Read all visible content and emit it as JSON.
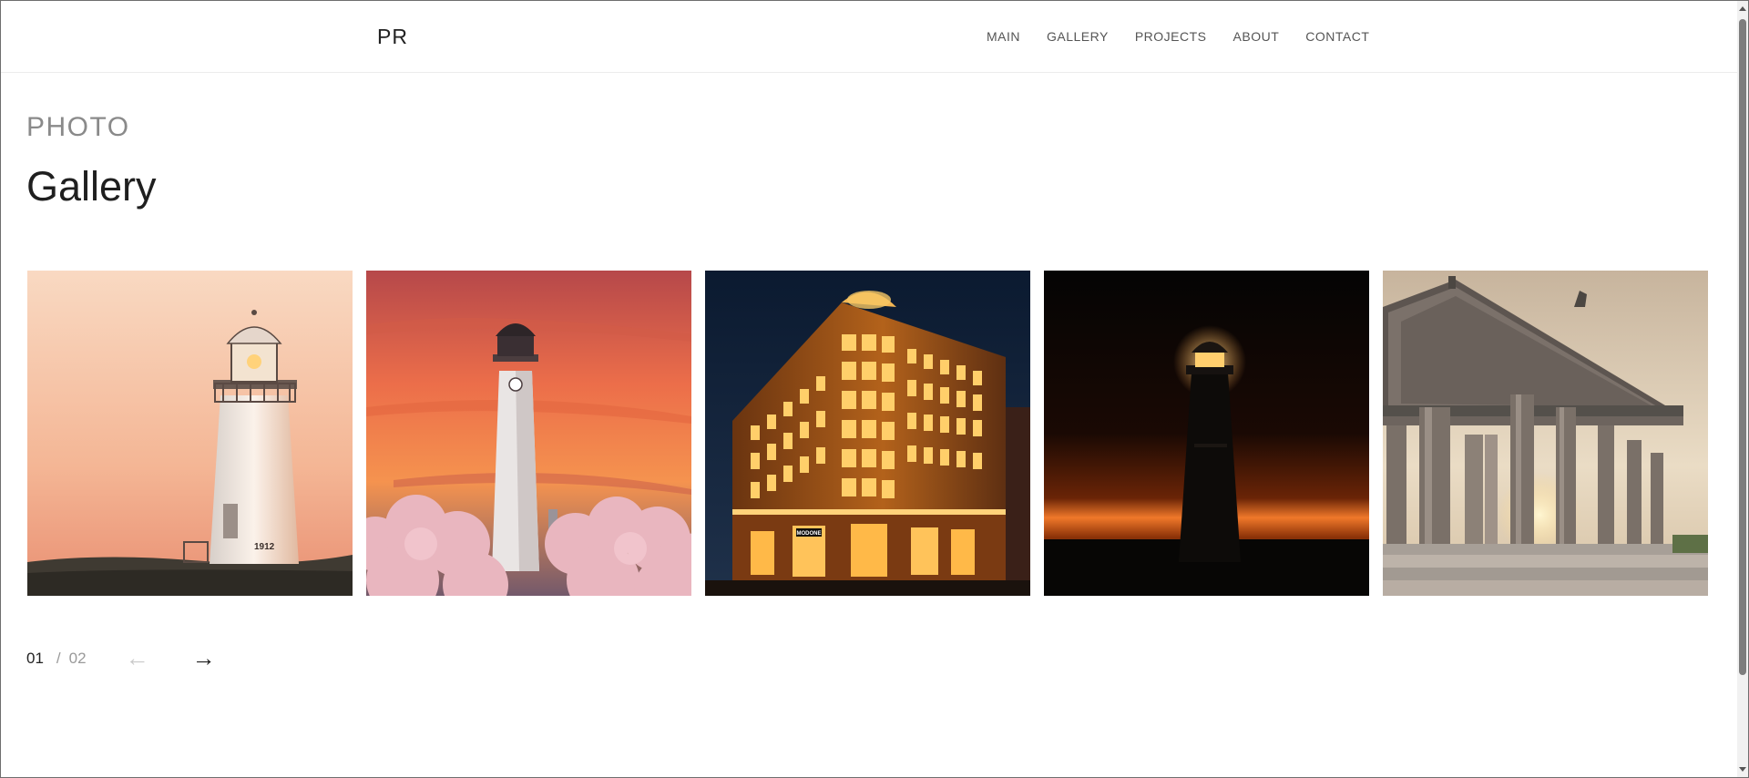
{
  "header": {
    "logo": "PR",
    "nav": [
      "MAIN",
      "GALLERY",
      "PROJECTS",
      "ABOUT",
      "CONTACT"
    ]
  },
  "hero": {
    "eyebrow": "PHOTO",
    "title": "Gallery"
  },
  "gallery": {
    "images": [
      {
        "name": "lighthouse-dusk-photo",
        "plaque_text": "1912",
        "sky_top": "#f7d2b6",
        "sky_bottom": "#f4a986"
      },
      {
        "name": "lighthouse-sunset-blossoms-photo",
        "sky_top": "#c65a4c",
        "sky_bottom": "#f38a4a"
      },
      {
        "name": "illuminated-building-night-photo",
        "sign_text": "MODONE",
        "sky_top": "#0d1d33",
        "sky_bottom": "#1b2e48"
      },
      {
        "name": "lighthouse-silhouette-night-photo",
        "sky_top": "#050505",
        "sky_bottom": "#2a0d04"
      },
      {
        "name": "classical-temple-sunset-photo",
        "sky_top": "#c9b8a1",
        "sky_bottom": "#e9dcc6"
      }
    ]
  },
  "pager": {
    "current": "01",
    "separator": "/",
    "total": "02",
    "prev_icon": "arrow-left-icon",
    "next_icon": "arrow-right-icon",
    "prev_glyph": "←",
    "next_glyph": "→"
  }
}
